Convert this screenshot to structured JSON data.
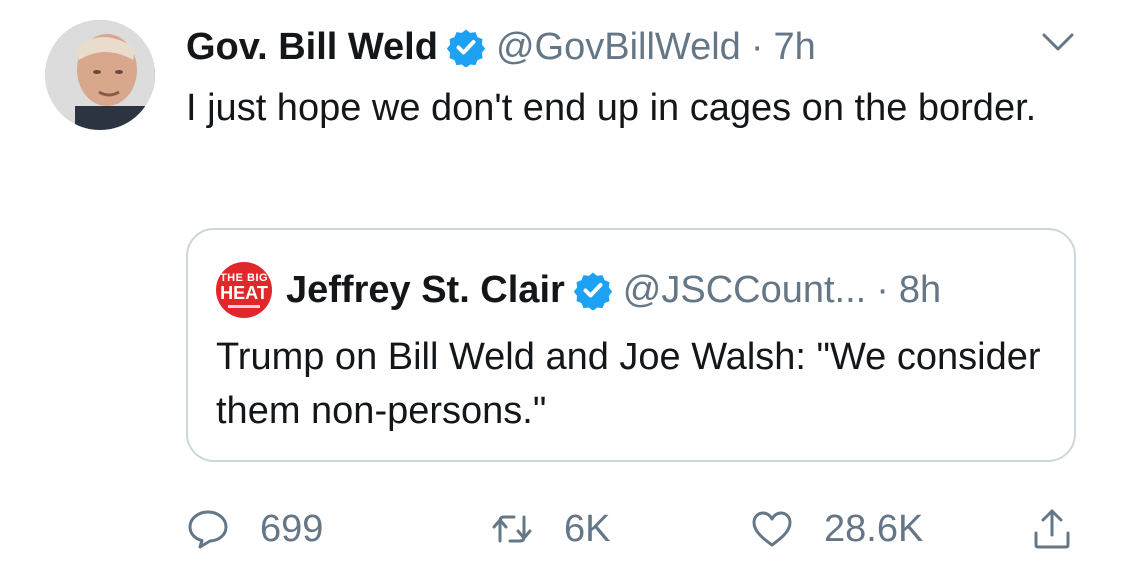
{
  "tweet": {
    "author_name": "Gov. Bill Weld",
    "handle": "@GovBillWeld",
    "separator": "·",
    "time": "7h",
    "text": "I just hope we don't end up in cages on the border."
  },
  "quoted_tweet": {
    "avatar_text_line1": "THE BIG",
    "avatar_text_line2": "HEAT",
    "author_name": "Jeffrey St. Clair",
    "handle": "@JSCCount...",
    "separator": "·",
    "time": "8h",
    "text": "Trump on Bill Weld and Joe Walsh: \"We consider them non-persons.\""
  },
  "actions": {
    "replies": "699",
    "retweets": "6K",
    "likes": "28.6K"
  },
  "colors": {
    "verified": "#1da1f2",
    "secondary_text": "#657786",
    "border": "#ccd6dd",
    "quote_avatar": "#e0282a"
  },
  "icons": [
    "chevron-down-icon",
    "verified-badge-icon",
    "reply-icon",
    "retweet-icon",
    "like-icon",
    "share-icon"
  ]
}
